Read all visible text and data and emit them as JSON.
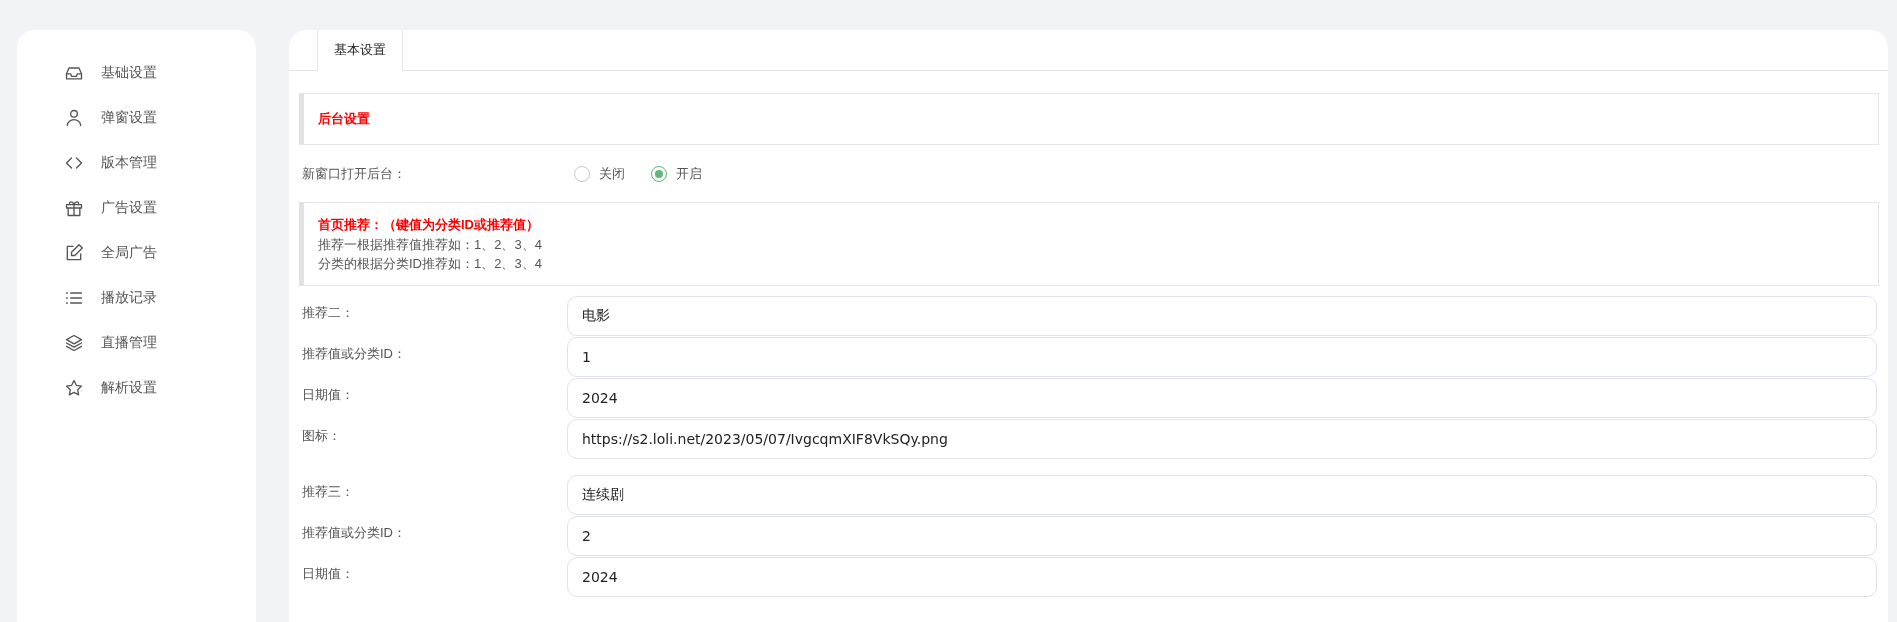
{
  "sidebar": {
    "items": [
      {
        "label": "基础设置",
        "selected": false
      },
      {
        "label": "弹窗设置",
        "selected": false
      },
      {
        "label": "版本管理",
        "selected": false
      },
      {
        "label": "广告设置",
        "selected": false
      },
      {
        "label": "全局广告",
        "selected": false
      },
      {
        "label": "播放记录",
        "selected": false
      },
      {
        "label": "直播管理",
        "selected": false
      },
      {
        "label": "解析设置",
        "selected": false
      }
    ]
  },
  "tabs": [
    {
      "label": "基本设置",
      "selected": true
    }
  ],
  "sections": [
    {
      "kind": "notice",
      "title": "后台设置"
    },
    {
      "kind": "radio",
      "label": "新窗口打开后台：",
      "options": [
        {
          "label": "关闭",
          "selected": false
        },
        {
          "label": "开启",
          "selected": true
        }
      ]
    },
    {
      "kind": "notice",
      "title": "首页推荐：（键值为分类ID或推荐值）",
      "lines": [
        "推荐一根据推荐值推荐如：1、2、3、4",
        "分类的根据分类ID推荐如：1、2、3、4"
      ]
    },
    {
      "kind": "fields",
      "fields": [
        {
          "label": "推荐二：",
          "value": "电影"
        },
        {
          "label": "推荐值或分类ID：",
          "value": "1"
        },
        {
          "label": "日期值：",
          "value": "2024"
        },
        {
          "label": "图标：",
          "value": "https://s2.loli.net/2023/05/07/IvgcqmXIF8VkSQy.png"
        }
      ]
    },
    {
      "kind": "fields",
      "fields": [
        {
          "label": "推荐三：",
          "value": "连续剧"
        },
        {
          "label": "推荐值或分类ID：",
          "value": "2"
        },
        {
          "label": "日期值：",
          "value": "2024"
        }
      ]
    }
  ]
}
